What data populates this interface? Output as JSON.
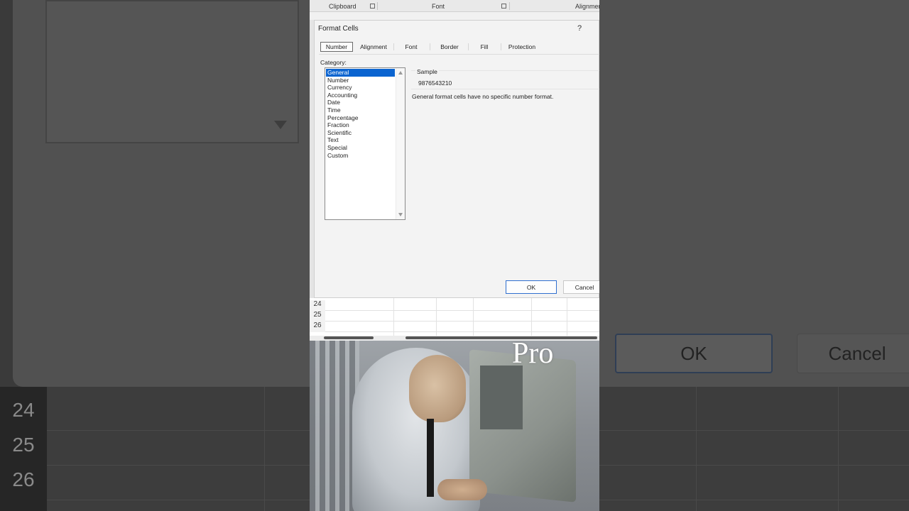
{
  "ribbon": {
    "clipboard": "Clipboard",
    "font": "Font",
    "alignment": "Alignmen"
  },
  "dialog": {
    "title": "Format Cells",
    "help": "?",
    "tabs": [
      {
        "label": "Number",
        "active": true
      },
      {
        "label": "Alignment"
      },
      {
        "label": "Font"
      },
      {
        "label": "Border"
      },
      {
        "label": "Fill"
      },
      {
        "label": "Protection"
      }
    ],
    "category_label": "Category:",
    "categories": [
      "General",
      "Number",
      "Currency",
      "Accounting",
      "Date",
      "Time",
      "Percentage",
      "Fraction",
      "Scientific",
      "Text",
      "Special",
      "Custom"
    ],
    "selected_category": "General",
    "sample_label": "Sample",
    "sample_value": "9876543210",
    "description": "General format cells have no specific number format.",
    "ok_label": "OK",
    "cancel_label": "Cancel"
  },
  "grid": {
    "rows": [
      "24",
      "25",
      "26"
    ]
  },
  "meme": {
    "caption": "Pro"
  },
  "background": {
    "ok_label": "OK",
    "cancel_label": "Cancel",
    "rows": [
      "24",
      "25",
      "26"
    ]
  },
  "colors": {
    "selection": "#0b64d0",
    "ok_border": "#2f6fcf"
  }
}
